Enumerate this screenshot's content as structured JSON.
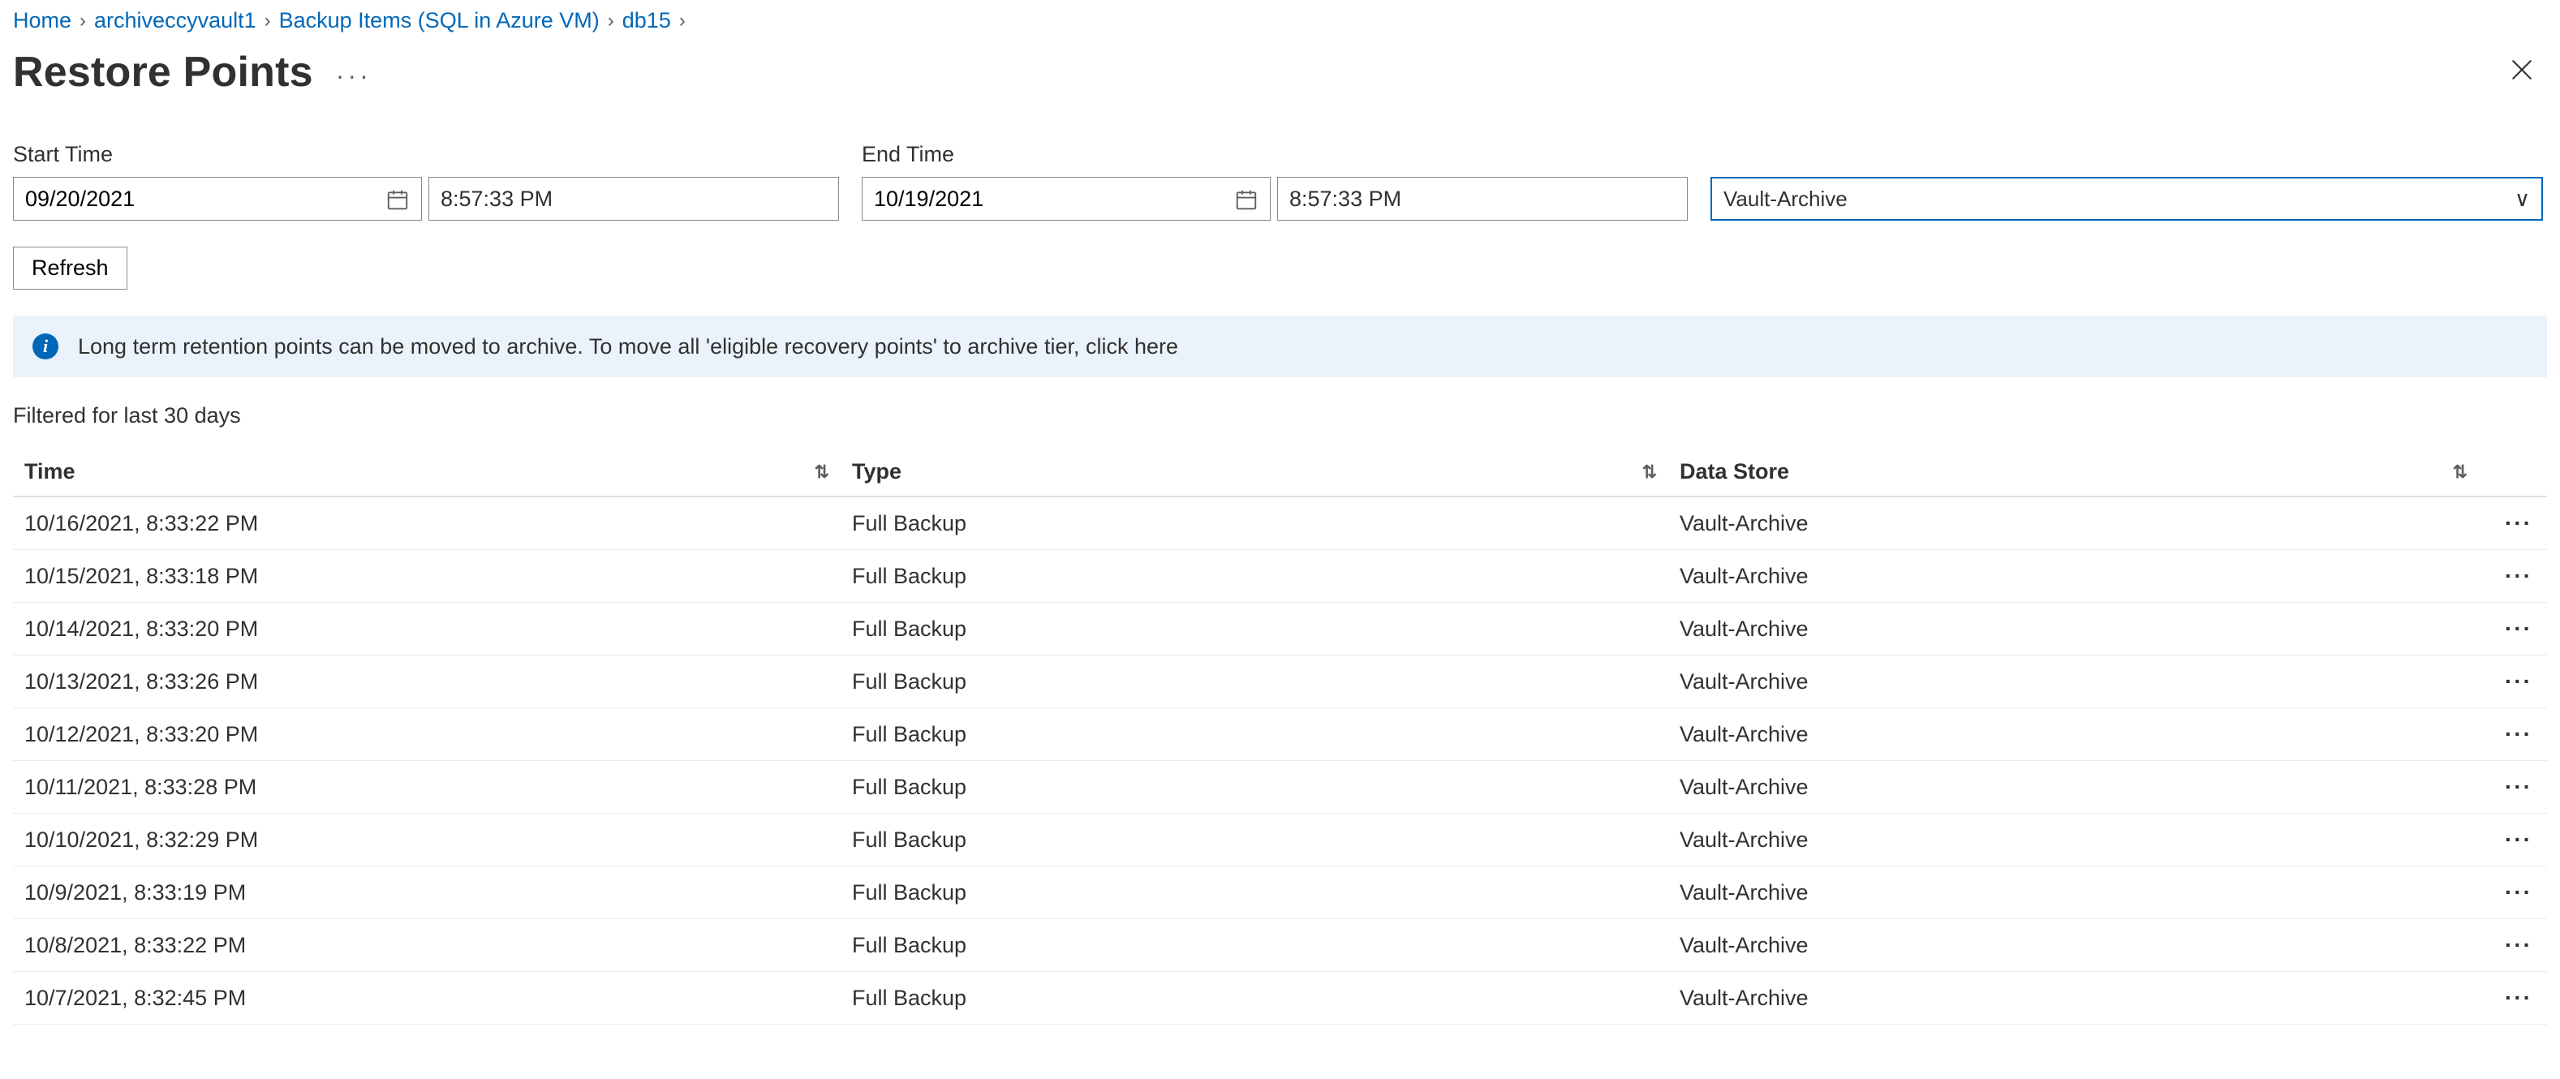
{
  "breadcrumb": {
    "items": [
      {
        "label": "Home"
      },
      {
        "label": "archiveccyvault1"
      },
      {
        "label": "Backup Items (SQL in Azure VM)"
      },
      {
        "label": "db15"
      }
    ]
  },
  "header": {
    "title": "Restore Points"
  },
  "filters": {
    "start_label": "Start Time",
    "end_label": "End Time",
    "start_date": "09/20/2021",
    "start_time": "8:57:33 PM",
    "end_date": "10/19/2021",
    "end_time": "8:57:33 PM",
    "tier_selected": "Vault-Archive"
  },
  "buttons": {
    "refresh": "Refresh"
  },
  "info": {
    "text": "Long term retention points can be moved to archive. To move all 'eligible recovery points' to archive tier, click here"
  },
  "caption": "Filtered for last 30 days",
  "table": {
    "headers": {
      "time": "Time",
      "type": "Type",
      "store": "Data Store"
    },
    "rows": [
      {
        "time": "10/16/2021, 8:33:22 PM",
        "type": "Full Backup",
        "store": "Vault-Archive"
      },
      {
        "time": "10/15/2021, 8:33:18 PM",
        "type": "Full Backup",
        "store": "Vault-Archive"
      },
      {
        "time": "10/14/2021, 8:33:20 PM",
        "type": "Full Backup",
        "store": "Vault-Archive"
      },
      {
        "time": "10/13/2021, 8:33:26 PM",
        "type": "Full Backup",
        "store": "Vault-Archive"
      },
      {
        "time": "10/12/2021, 8:33:20 PM",
        "type": "Full Backup",
        "store": "Vault-Archive"
      },
      {
        "time": "10/11/2021, 8:33:28 PM",
        "type": "Full Backup",
        "store": "Vault-Archive"
      },
      {
        "time": "10/10/2021, 8:32:29 PM",
        "type": "Full Backup",
        "store": "Vault-Archive"
      },
      {
        "time": "10/9/2021, 8:33:19 PM",
        "type": "Full Backup",
        "store": "Vault-Archive"
      },
      {
        "time": "10/8/2021, 8:33:22 PM",
        "type": "Full Backup",
        "store": "Vault-Archive"
      },
      {
        "time": "10/7/2021, 8:32:45 PM",
        "type": "Full Backup",
        "store": "Vault-Archive"
      }
    ]
  }
}
